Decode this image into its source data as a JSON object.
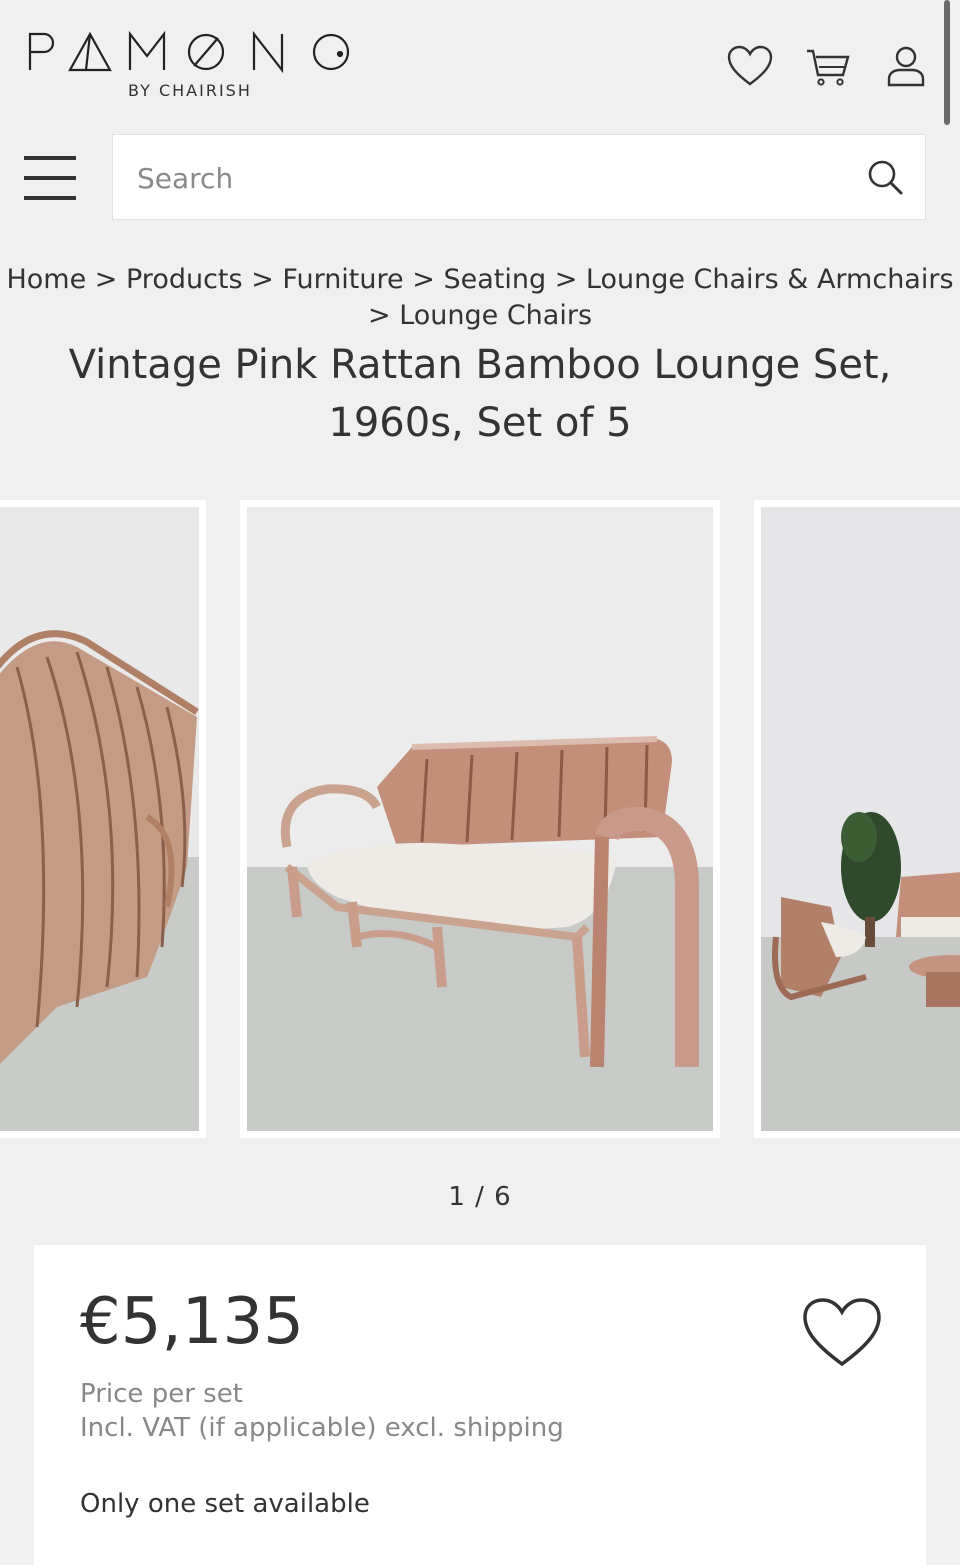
{
  "brand": {
    "name_letters": [
      "P",
      "A",
      "M",
      "O",
      "N",
      "O"
    ],
    "tagline": "BY CHAIRISH"
  },
  "header": {
    "icons": [
      "heart-icon",
      "cart-icon",
      "user-icon"
    ]
  },
  "search": {
    "placeholder": "Search"
  },
  "breadcrumb": {
    "items": [
      "Home",
      "Products",
      "Furniture",
      "Seating",
      "Lounge Chairs & Armchairs",
      "Lounge Chairs"
    ],
    "separator": ">"
  },
  "product": {
    "title": "Vintage Pink Rattan Bamboo Lounge Set, 1960s, Set of 5",
    "gallery_counter": "1 / 6",
    "price": "€5,135",
    "price_unit": "Price per set",
    "price_terms": "Incl. VAT (if applicable) excl. shipping",
    "availability": "Only one set available"
  },
  "colors": {
    "background": "#f0f0f0",
    "text": "#333333",
    "muted": "#888888",
    "rattan": "#c48f7a"
  }
}
